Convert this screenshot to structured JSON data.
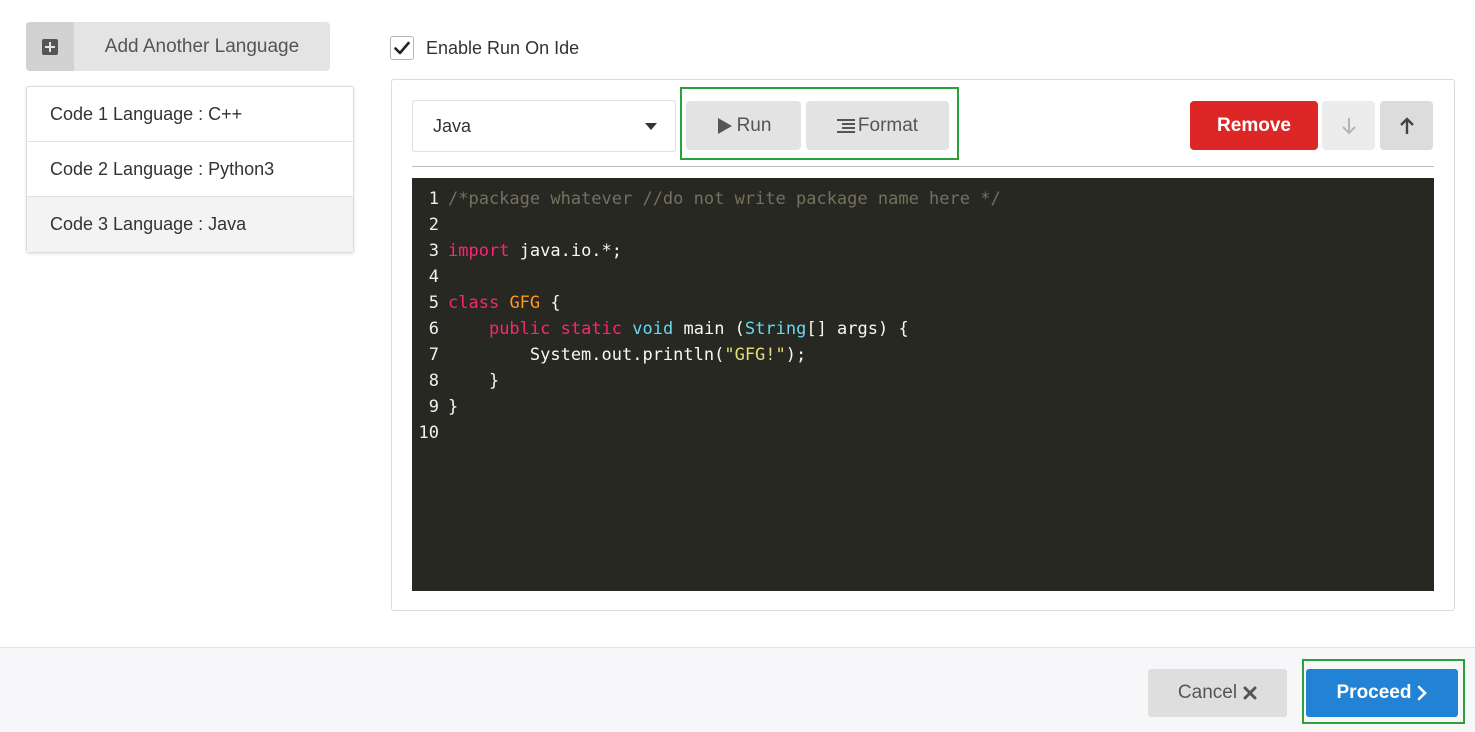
{
  "sidebar": {
    "add_button_label": "Add Another Language",
    "items": [
      {
        "label": "Code 1 Language : C++",
        "active": false
      },
      {
        "label": "Code 2 Language : Python3",
        "active": false
      },
      {
        "label": "Code 3 Language : Java",
        "active": true
      }
    ]
  },
  "settings": {
    "enable_run_label": "Enable Run On Ide",
    "enable_run_checked": true
  },
  "editor": {
    "language_selected": "Java",
    "run_label": "Run",
    "format_label": "Format",
    "remove_label": "Remove",
    "lines": [
      {
        "n": "1",
        "tokens": [
          {
            "t": "/*package whatever //do not write package name here */",
            "c": "comment"
          }
        ]
      },
      {
        "n": "2",
        "tokens": []
      },
      {
        "n": "3",
        "tokens": [
          {
            "t": "import",
            "c": "kw"
          },
          {
            "t": " java.io.*;",
            "c": "plain"
          }
        ]
      },
      {
        "n": "4",
        "tokens": []
      },
      {
        "n": "5",
        "tokens": [
          {
            "t": "class",
            "c": "kw"
          },
          {
            "t": " ",
            "c": "plain"
          },
          {
            "t": "GFG",
            "c": "cls"
          },
          {
            "t": " {",
            "c": "plain"
          }
        ]
      },
      {
        "n": "6",
        "tokens": [
          {
            "t": "    ",
            "c": "plain"
          },
          {
            "t": "public",
            "c": "kw"
          },
          {
            "t": " ",
            "c": "plain"
          },
          {
            "t": "static",
            "c": "kw"
          },
          {
            "t": " ",
            "c": "plain"
          },
          {
            "t": "void",
            "c": "type"
          },
          {
            "t": " main (",
            "c": "plain"
          },
          {
            "t": "String",
            "c": "type"
          },
          {
            "t": "[] args) {",
            "c": "plain"
          }
        ]
      },
      {
        "n": "7",
        "tokens": [
          {
            "t": "        System.out.println(",
            "c": "plain"
          },
          {
            "t": "\"GFG!\"",
            "c": "str"
          },
          {
            "t": ");",
            "c": "plain"
          }
        ]
      },
      {
        "n": "8",
        "tokens": [
          {
            "t": "    }",
            "c": "plain"
          }
        ]
      },
      {
        "n": "9",
        "tokens": [
          {
            "t": "}",
            "c": "plain"
          }
        ]
      },
      {
        "n": "10",
        "tokens": []
      }
    ]
  },
  "footer": {
    "cancel_label": "Cancel",
    "proceed_label": "Proceed"
  },
  "colors": {
    "remove": "#dd2727",
    "proceed": "#2283d4",
    "highlight": "#2aa13a",
    "editor_bg": "#272822"
  }
}
